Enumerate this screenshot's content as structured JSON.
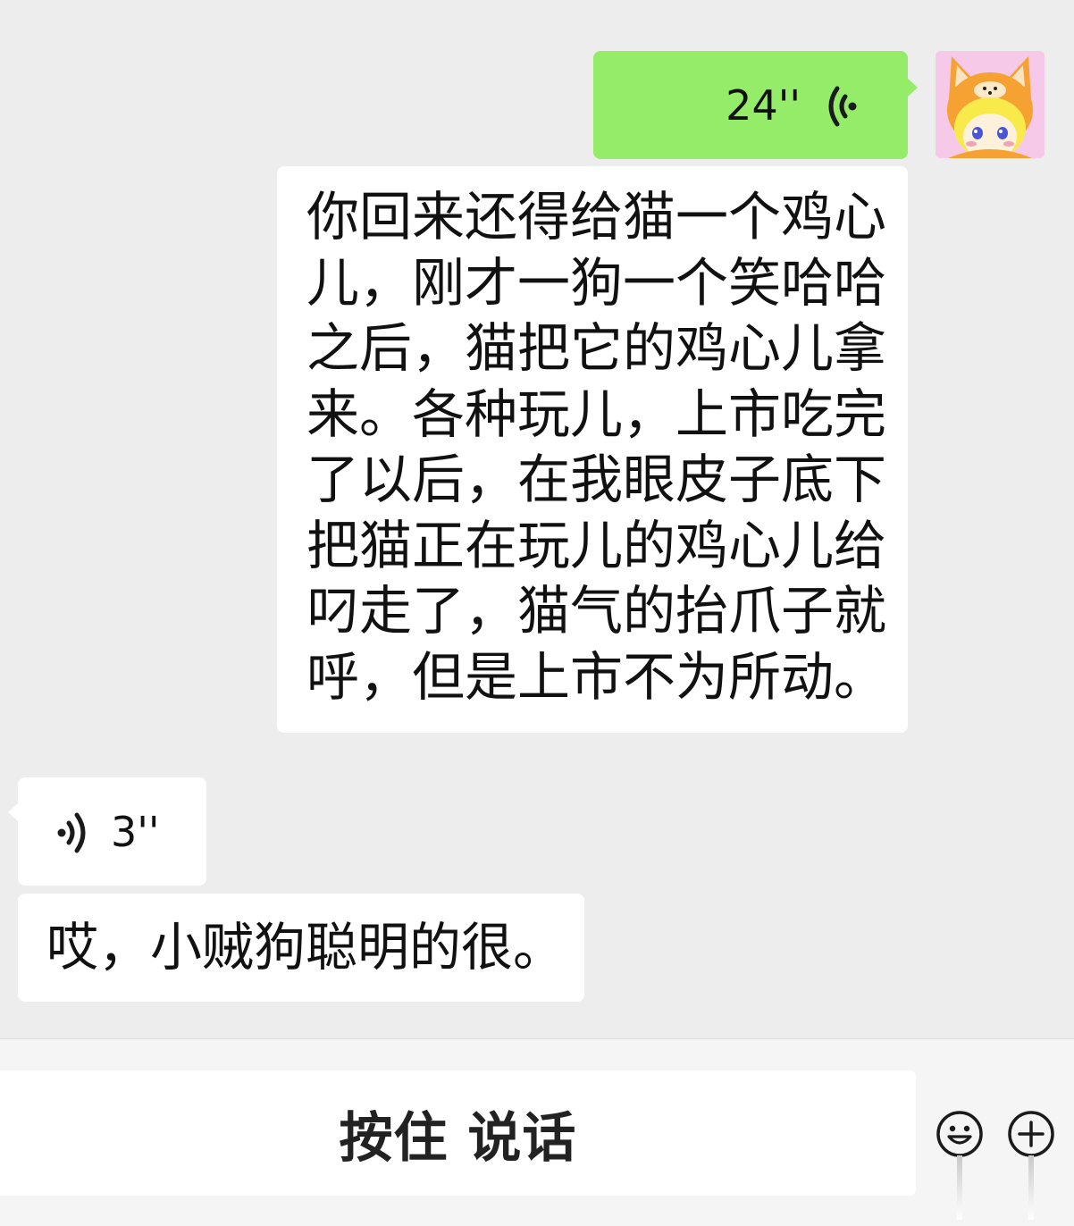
{
  "chat": {
    "messages": [
      {
        "direction": "outgoing",
        "type": "voice",
        "duration": "24''"
      },
      {
        "direction": "outgoing",
        "type": "text",
        "text": "你回来还得给猫一个鸡心儿，刚才一狗一个笑哈哈之后，猫把它的鸡心儿拿来。各种玩儿，上市吃完了以后，在我眼皮子底下把猫正在玩儿的鸡心儿给叼走了，猫气的抬爪子就呼，但是上市不为所动。"
      },
      {
        "direction": "incoming",
        "type": "voice",
        "duration": "3''"
      },
      {
        "direction": "incoming",
        "type": "text",
        "text": "哎，小贼狗聪明的很。"
      }
    ],
    "avatar_icon": "fox-costume-avatar-icon"
  },
  "input_bar": {
    "hold_to_talk_label": "按住 说话",
    "emoji_icon": "smiley-face-icon",
    "plus_icon": "plus-circle-icon"
  },
  "colors": {
    "background": "#ededed",
    "outgoing_bubble": "#95ec69",
    "incoming_bubble": "#ffffff"
  }
}
